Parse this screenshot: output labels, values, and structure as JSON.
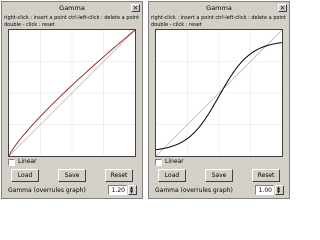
{
  "windows": [
    {
      "title": "Gamma",
      "close_icon": "×",
      "help_line1": "right-click : insert a point   ctrl-left-click : delete a point",
      "help_line2": "double - click : reset",
      "linear_label": "Linear",
      "linear_checked": false,
      "load_label": "Load",
      "save_label": "Save",
      "reset_label": "Reset",
      "gamma_label": "Gamma (overrules graph)",
      "gamma_value": "1.20",
      "curve_gamma": 1.2,
      "curve_color": "#9b1b1b"
    },
    {
      "title": "Gamma",
      "close_icon": "×",
      "help_line1": "right-click : insert a point   ctrl-left-click : delete a point",
      "help_line2": "double - click : reset",
      "linear_label": "Linear",
      "linear_checked": false,
      "load_label": "Load",
      "save_label": "Save",
      "reset_label": "Reset",
      "gamma_label": "Gamma (overrules graph)",
      "gamma_value": "1.00",
      "curve_type": "s-curve",
      "curve_color": "#000000"
    }
  ],
  "colors": {
    "diagonal": "#bdbdbd",
    "grid": "#e2e2e2"
  }
}
